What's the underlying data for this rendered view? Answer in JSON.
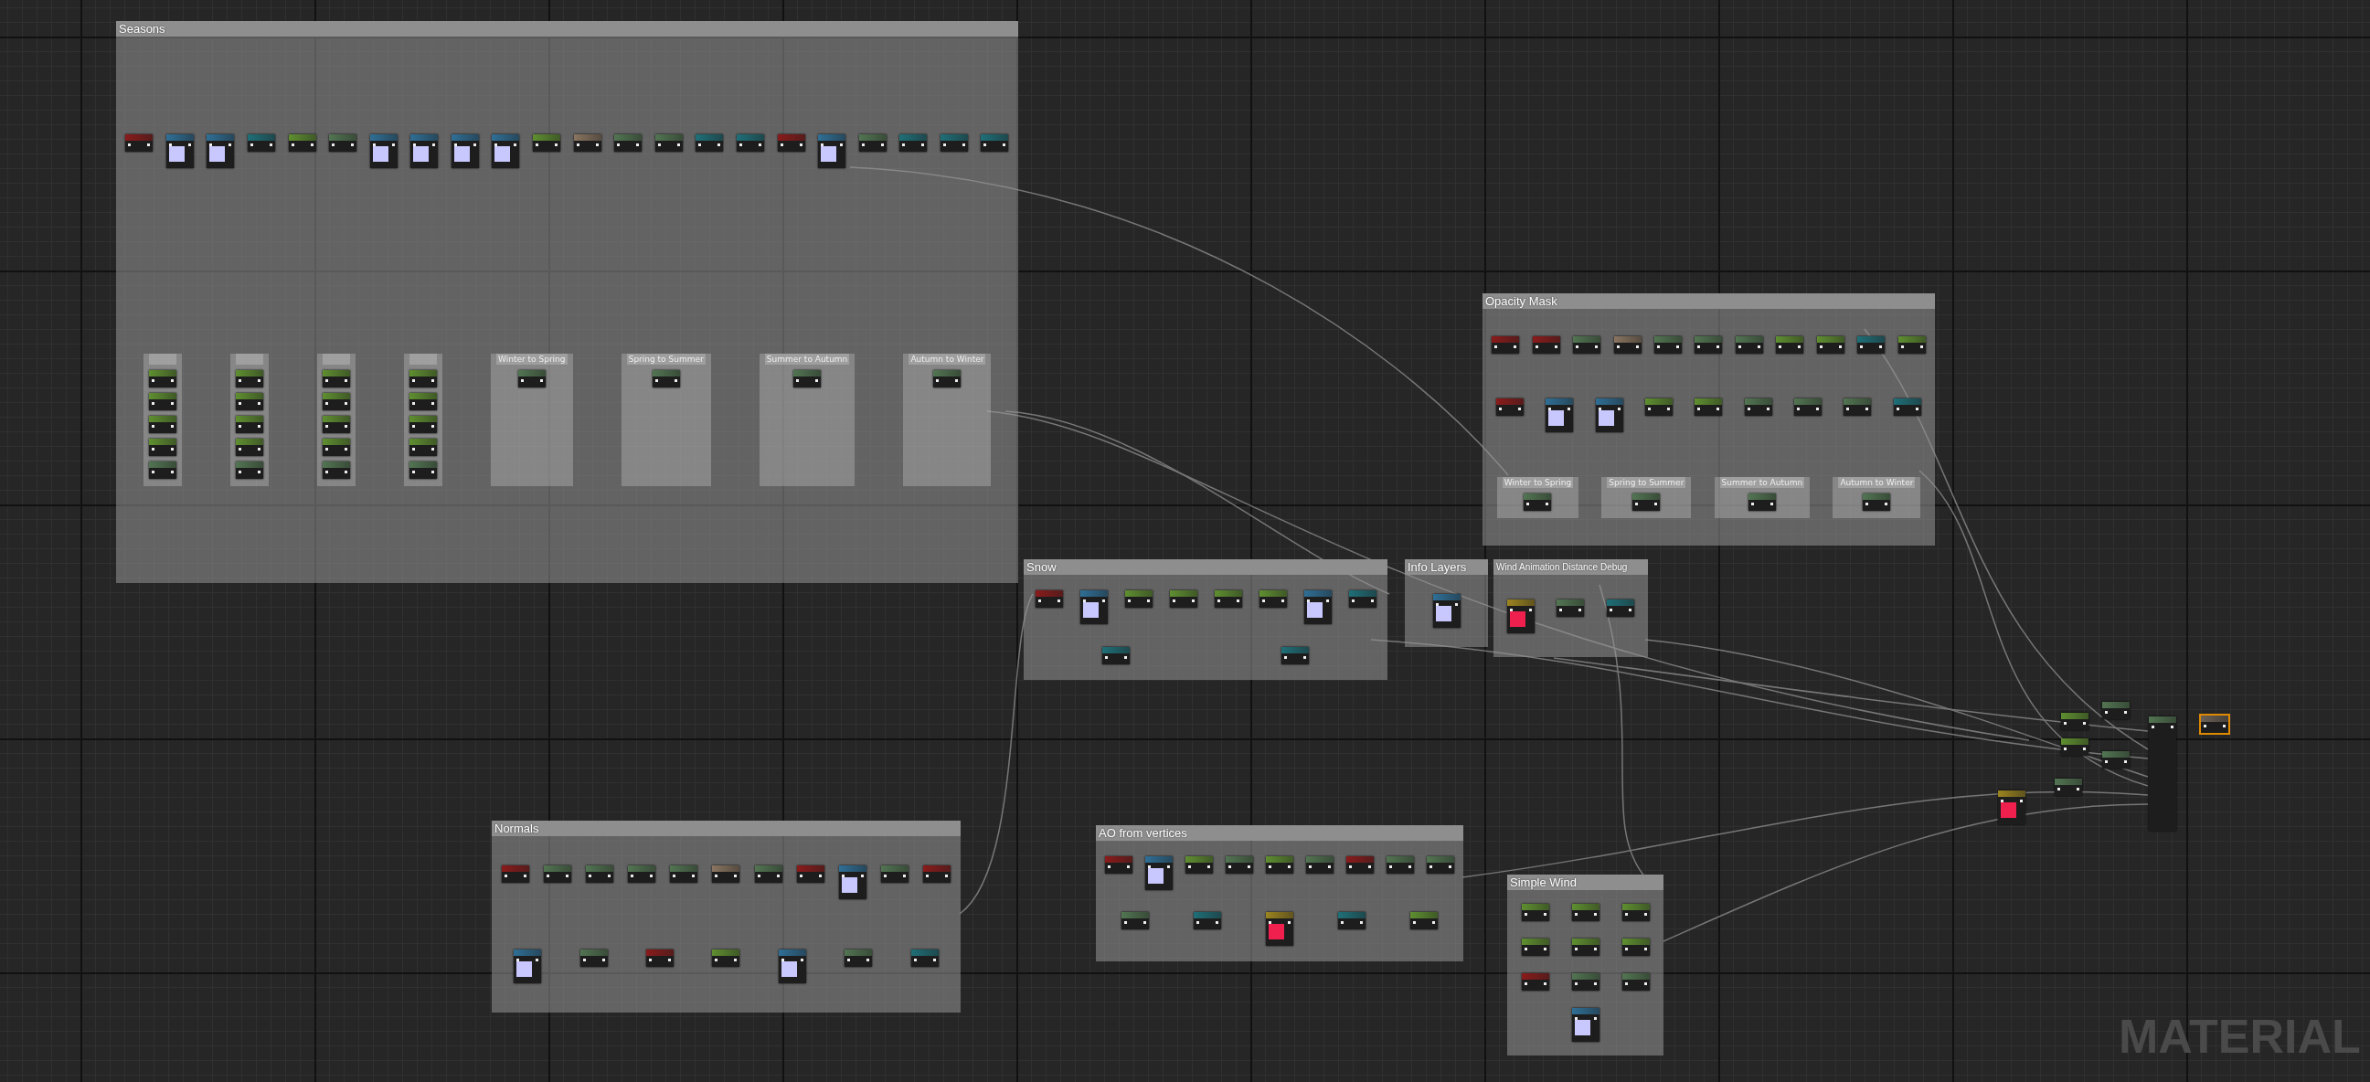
{
  "graph": {
    "comments": [
      {
        "title": "Seasons",
        "nodes": [
          {
            "kind": "param"
          },
          {
            "kind": "texture"
          },
          {
            "kind": "texture"
          },
          {
            "kind": "math"
          },
          {
            "kind": "scalar"
          },
          {
            "kind": "function"
          },
          {
            "kind": "texture"
          },
          {
            "kind": "texture"
          },
          {
            "kind": "texture"
          },
          {
            "kind": "texture"
          },
          {
            "kind": "scalar"
          },
          {
            "kind": "constant"
          },
          {
            "kind": "function"
          },
          {
            "kind": "function"
          },
          {
            "kind": "math"
          },
          {
            "kind": "math"
          },
          {
            "kind": "param"
          },
          {
            "kind": "texture"
          },
          {
            "kind": "function"
          },
          {
            "kind": "math"
          },
          {
            "kind": "math"
          },
          {
            "kind": "math"
          }
        ],
        "groups": [
          {
            "nodes": [
              {
                "kind": "scalar"
              },
              {
                "kind": "scalar"
              },
              {
                "kind": "scalar"
              },
              {
                "kind": "scalar"
              },
              {
                "kind": "function"
              }
            ]
          },
          {
            "nodes": [
              {
                "kind": "scalar"
              },
              {
                "kind": "scalar"
              },
              {
                "kind": "scalar"
              },
              {
                "kind": "scalar"
              },
              {
                "kind": "function"
              }
            ]
          },
          {
            "nodes": [
              {
                "kind": "scalar"
              },
              {
                "kind": "scalar"
              },
              {
                "kind": "scalar"
              },
              {
                "kind": "scalar"
              },
              {
                "kind": "function"
              }
            ]
          },
          {
            "nodes": [
              {
                "kind": "scalar"
              },
              {
                "kind": "scalar"
              },
              {
                "kind": "scalar"
              },
              {
                "kind": "scalar"
              },
              {
                "kind": "function"
              }
            ]
          },
          {
            "title": "Winter to Spring",
            "nodes": [
              {
                "kind": "function"
              }
            ]
          },
          {
            "title": "Spring to Summer",
            "nodes": [
              {
                "kind": "function"
              }
            ]
          },
          {
            "title": "Summer to Autumn",
            "nodes": [
              {
                "kind": "function"
              }
            ]
          },
          {
            "title": "Autumn to Winter",
            "nodes": [
              {
                "kind": "function"
              }
            ]
          }
        ]
      },
      {
        "title": "Opacity Mask",
        "nodes": [
          {
            "kind": "param"
          },
          {
            "kind": "param"
          },
          {
            "kind": "function"
          },
          {
            "kind": "constant"
          },
          {
            "kind": "function"
          },
          {
            "kind": "function"
          },
          {
            "kind": "function"
          },
          {
            "kind": "scalar"
          },
          {
            "kind": "scalar"
          },
          {
            "kind": "math"
          },
          {
            "kind": "scalar"
          },
          {
            "kind": "param"
          },
          {
            "kind": "texture"
          },
          {
            "kind": "texture"
          },
          {
            "kind": "scalar"
          },
          {
            "kind": "scalar"
          },
          {
            "kind": "function"
          },
          {
            "kind": "function"
          },
          {
            "kind": "function"
          },
          {
            "kind": "math"
          }
        ],
        "groups": [
          {
            "title": "Winter to Spring",
            "nodes": [
              {
                "kind": "function"
              }
            ]
          },
          {
            "title": "Spring to Summer",
            "nodes": [
              {
                "kind": "function"
              }
            ]
          },
          {
            "title": "Summer to Autumn",
            "nodes": [
              {
                "kind": "function"
              }
            ]
          },
          {
            "title": "Autumn to Winter",
            "nodes": [
              {
                "kind": "function"
              }
            ]
          }
        ]
      },
      {
        "title": "Snow",
        "nodes": [
          {
            "kind": "param"
          },
          {
            "kind": "texture"
          },
          {
            "kind": "scalar"
          },
          {
            "kind": "scalar"
          },
          {
            "kind": "scalar"
          },
          {
            "kind": "scalar"
          },
          {
            "kind": "texture"
          },
          {
            "kind": "math"
          },
          {
            "kind": "math"
          },
          {
            "kind": "math"
          }
        ]
      },
      {
        "title": "Info Layers",
        "nodes": [
          {
            "kind": "texture"
          }
        ]
      },
      {
        "title": "Wind Animation Distance Debug",
        "nodes": [
          {
            "kind": "color"
          },
          {
            "kind": "function"
          },
          {
            "kind": "math"
          }
        ]
      },
      {
        "title": "Normals",
        "nodes": [
          {
            "kind": "param"
          },
          {
            "kind": "function"
          },
          {
            "kind": "function"
          },
          {
            "kind": "function"
          },
          {
            "kind": "function"
          },
          {
            "kind": "constant"
          },
          {
            "kind": "function"
          },
          {
            "kind": "param"
          },
          {
            "kind": "texture"
          },
          {
            "kind": "function"
          },
          {
            "kind": "param"
          },
          {
            "kind": "texture"
          },
          {
            "kind": "function"
          },
          {
            "kind": "param"
          },
          {
            "kind": "scalar"
          },
          {
            "kind": "texture"
          },
          {
            "kind": "function"
          },
          {
            "kind": "math"
          }
        ]
      },
      {
        "title": "AO from vertices",
        "nodes": [
          {
            "kind": "param"
          },
          {
            "kind": "texture"
          },
          {
            "kind": "scalar"
          },
          {
            "kind": "function"
          },
          {
            "kind": "scalar"
          },
          {
            "kind": "function"
          },
          {
            "kind": "param"
          },
          {
            "kind": "function"
          },
          {
            "kind": "function"
          },
          {
            "kind": "function"
          },
          {
            "kind": "math"
          },
          {
            "kind": "color"
          },
          {
            "kind": "math"
          },
          {
            "kind": "scalar"
          }
        ]
      },
      {
        "title": "Simple Wind",
        "nodes": [
          {
            "kind": "scalar"
          },
          {
            "kind": "scalar"
          },
          {
            "kind": "scalar"
          },
          {
            "kind": "scalar"
          },
          {
            "kind": "scalar"
          },
          {
            "kind": "scalar"
          },
          {
            "kind": "param"
          },
          {
            "kind": "function"
          },
          {
            "kind": "function"
          },
          {
            "kind": "texture"
          }
        ]
      }
    ],
    "loose_nodes": [
      {
        "kind": "scalar"
      },
      {
        "kind": "function"
      },
      {
        "kind": "scalar"
      },
      {
        "kind": "function"
      },
      {
        "kind": "color"
      },
      {
        "kind": "function"
      },
      {
        "kind": "result"
      },
      {
        "kind": "selected"
      }
    ],
    "graph_type": "MATERIAL"
  }
}
